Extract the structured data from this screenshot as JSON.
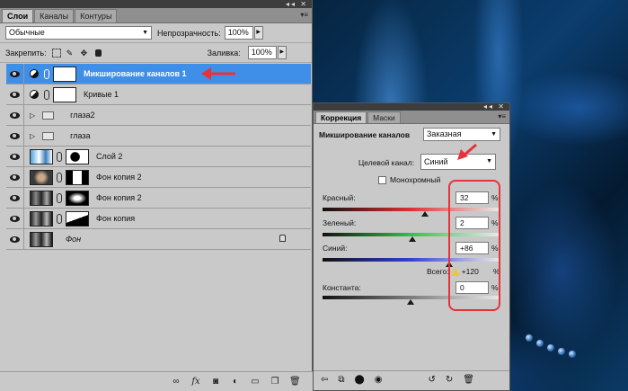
{
  "layers_panel": {
    "tabs": [
      "Слои",
      "Каналы",
      "Контуры"
    ],
    "blend_mode": "Обычные",
    "opacity_label": "Непрозрачность:",
    "opacity_value": "100%",
    "lock_label": "Закрепить:",
    "fill_label": "Заливка:",
    "fill_value": "100%",
    "layers": [
      {
        "name": "Микширование каналов 1",
        "type": "adjustment",
        "selected": true
      },
      {
        "name": "Кривые 1",
        "type": "adjustment",
        "selected": false
      },
      {
        "name": "глаза2",
        "type": "group",
        "selected": false
      },
      {
        "name": "глаза",
        "type": "group",
        "selected": false
      },
      {
        "name": "Слой 2",
        "type": "layer-mask",
        "selected": false
      },
      {
        "name": "Фон копия 2",
        "type": "layer-mask",
        "selected": false
      },
      {
        "name": "Фон копия 2",
        "type": "layer-mask",
        "selected": false
      },
      {
        "name": "Фон копия",
        "type": "layer-mask",
        "selected": false
      },
      {
        "name": "Фон",
        "type": "background",
        "selected": false
      }
    ],
    "bottom_icons": [
      "link-icon",
      "fx-icon",
      "add-mask-icon",
      "new-adjustment-icon",
      "new-group-icon",
      "new-layer-icon",
      "trash-icon"
    ]
  },
  "correction_panel": {
    "tabs": [
      "Коррекция",
      "Маски"
    ],
    "title": "Микширование каналов",
    "preset": "Заказная",
    "target_channel_label": "Целевой канал:",
    "target_channel": "Синий",
    "monochrome_label": "Монохромный",
    "monochrome_checked": false,
    "sliders": [
      {
        "label": "Красный:",
        "value": "32",
        "unit": "%",
        "fraction": 0.58
      },
      {
        "label": "Зеленый:",
        "value": "2",
        "unit": "%",
        "fraction": 0.51
      },
      {
        "label": "Синий:",
        "value": "+86",
        "unit": "%",
        "fraction": 0.72
      },
      {
        "label": "Константа:",
        "value": "0",
        "unit": "%",
        "fraction": 0.5
      }
    ],
    "total_label": "Всего:",
    "total_value": "+120",
    "total_unit": "%",
    "bottom_icons": [
      "back-icon",
      "clip-icon",
      "visibility-icon",
      "eye-icon",
      "reset-prev-icon",
      "reset-icon",
      "trash-icon"
    ]
  },
  "colors": {
    "selection": "#3f8ee8",
    "annotation_red": "#e8323a",
    "panel_bg": "#c9c9c9"
  }
}
